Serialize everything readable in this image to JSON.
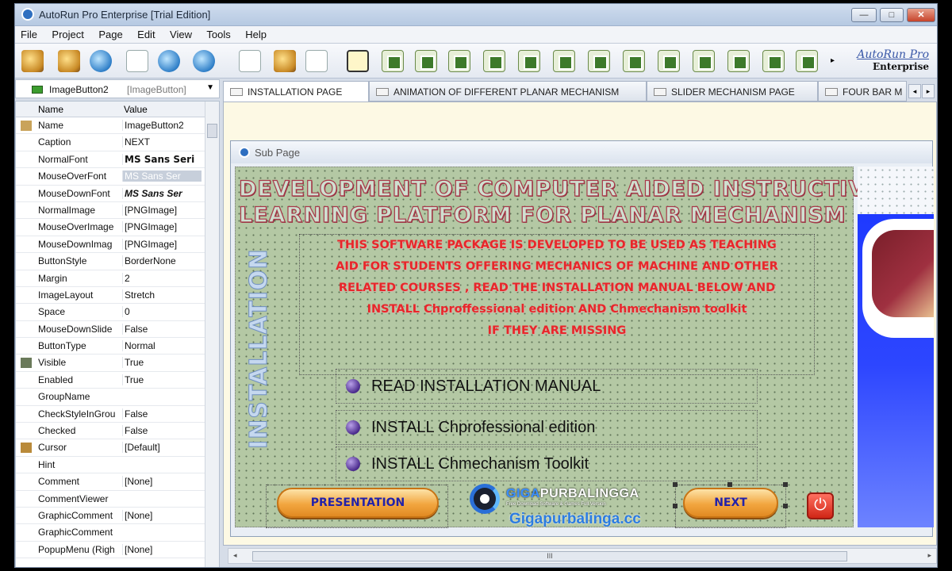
{
  "window": {
    "title": "AutoRun Pro Enterprise [Trial Edition]",
    "buttons": {
      "minimize": "—",
      "maximize": "□",
      "close": "✕"
    }
  },
  "menu": [
    "File",
    "Project",
    "Page",
    "Edit",
    "View",
    "Tools",
    "Help"
  ],
  "brand": {
    "line1": "AutoRun Pro",
    "line2": "Enterprise"
  },
  "object_selector": {
    "name": "ImageButton2",
    "type": "[ImageButton]",
    "arrow": "▼"
  },
  "properties": {
    "headers": {
      "name": "Name",
      "value": "Value"
    },
    "rows": [
      {
        "name": "Name",
        "value": "ImageButton2"
      },
      {
        "name": "Caption",
        "value": "NEXT"
      },
      {
        "name": "NormalFont",
        "value": "MS Sans Seri"
      },
      {
        "name": "MouseOverFont",
        "value": "MS Sans Ser"
      },
      {
        "name": "MouseDownFont",
        "value": "MS Sans Ser"
      },
      {
        "name": "NormalImage",
        "value": "[PNGImage]"
      },
      {
        "name": "MouseOverImage",
        "value": "[PNGImage]"
      },
      {
        "name": "MouseDownImag",
        "value": "[PNGImage]"
      },
      {
        "name": "ButtonStyle",
        "value": "BorderNone"
      },
      {
        "name": "Margin",
        "value": "2"
      },
      {
        "name": "ImageLayout",
        "value": "Stretch"
      },
      {
        "name": "Space",
        "value": "0"
      },
      {
        "name": "MouseDownSlide",
        "value": "False"
      },
      {
        "name": "ButtonType",
        "value": "Normal"
      },
      {
        "name": "Visible",
        "value": "True"
      },
      {
        "name": "Enabled",
        "value": "True"
      },
      {
        "name": "GroupName",
        "value": ""
      },
      {
        "name": "CheckStyleInGrou",
        "value": "False"
      },
      {
        "name": "Checked",
        "value": "False"
      },
      {
        "name": "Cursor",
        "value": "[Default]"
      },
      {
        "name": "Hint",
        "value": ""
      },
      {
        "name": "Comment",
        "value": "[None]"
      },
      {
        "name": "CommentViewer",
        "value": ""
      },
      {
        "name": "GraphicComment",
        "value": "[None]"
      },
      {
        "name": "GraphicComment",
        "value": ""
      },
      {
        "name": "PopupMenu (Righ",
        "value": "[None]"
      }
    ]
  },
  "tabs": [
    "INSTALLATION PAGE",
    "ANIMATION OF DIFFERENT PLANAR MECHANISM",
    "SLIDER MECHANISM PAGE",
    "FOUR BAR M"
  ],
  "subpage": {
    "title": "Sub Page",
    "heading_line1": "DEVELOPMENT OF COMPUTER AIDED INSTRUCTIVE",
    "heading_line2": "LEARNING PLATFORM FOR PLANAR MECHANISM",
    "vertical_label": "INSTALLATION",
    "info_lines": [
      "THIS SOFTWARE PACKAGE IS DEVELOPED TO BE USED AS TEACHING",
      "AID FOR STUDENTS OFFERING MECHANICS OF MACHINE AND OTHER",
      "RELATED COURSES , READ THE INSTALLATION MANUAL BELOW AND",
      "INSTALL Chproffessional edition AND Chmechanism toolkit",
      "IF THEY ARE MISSING"
    ],
    "menu_items": [
      "READ INSTALLATION MANUAL",
      "INSTALL Chprofessional edition",
      "INSTALL Chmechanism Toolkit"
    ],
    "presentation_button": "PRESENTATION",
    "next_button": "NEXT",
    "power_icon": "⏻"
  },
  "watermark": {
    "brand_a": "GIGA",
    "brand_b": "PURBALINGGA",
    "tagline": "Free Download Software & Games Full Version",
    "url": "Gigapurbalinga.cc"
  },
  "scrollbar_grip": "III"
}
